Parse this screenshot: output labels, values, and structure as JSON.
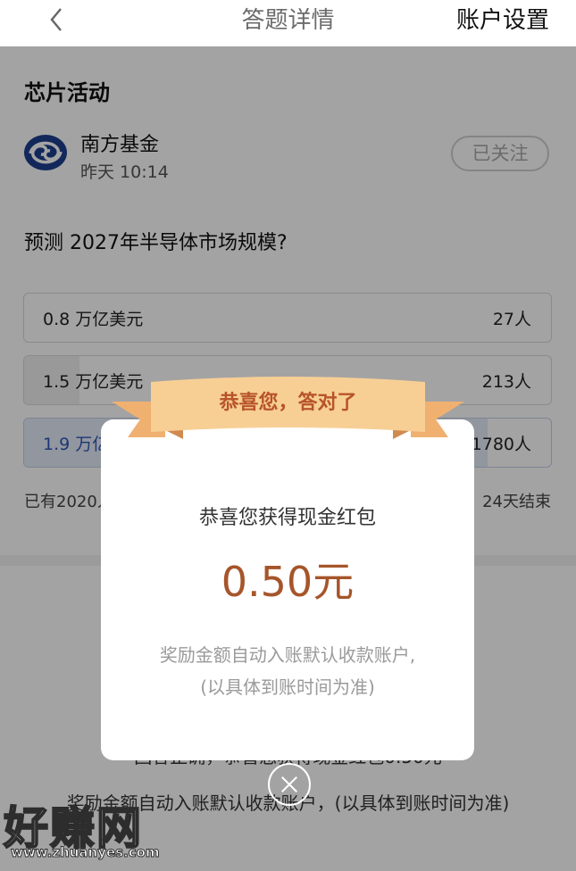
{
  "nav": {
    "title": "答题详情",
    "settings": "账户设置",
    "back_icon": "chevron-left-icon"
  },
  "activity": {
    "section_title": "芯片活动",
    "author_name": "南方基金",
    "author_time": "昨天 10:14",
    "follow_label": "已关注",
    "question": "预测 2027年半导体市场规模?"
  },
  "options": [
    {
      "label": "0.8 万亿美元",
      "count": "27人",
      "share": 0.0
    },
    {
      "label": "1.5 万亿美元",
      "count": "213人",
      "share": 0.105
    },
    {
      "label": "1.9 万亿美元",
      "count": "1780人",
      "share": 0.88,
      "selected": true
    }
  ],
  "footer": {
    "participants": "已有2020人参与",
    "deadline": "24天结束"
  },
  "result": {
    "line1": "回答正确，恭喜您获得现金红包0.50元",
    "line2": "奖励金额自动入账默认收款账户，(以具体到账时间为准)"
  },
  "modal": {
    "ribbon": "恭喜您，答对了",
    "line1": "恭喜您获得现金红包",
    "amount": "0.50元",
    "line3": "奖励金额自动入账默认收款账户,",
    "line4": "(以具体到账时间为准)",
    "close_icon": "close-icon"
  },
  "watermark": {
    "text": "好赚网",
    "url": "www.zhuanyes.com"
  },
  "colors": {
    "accent": "#a6552a",
    "ribbon": "#f5c98b",
    "selected": "#2e56b8"
  }
}
